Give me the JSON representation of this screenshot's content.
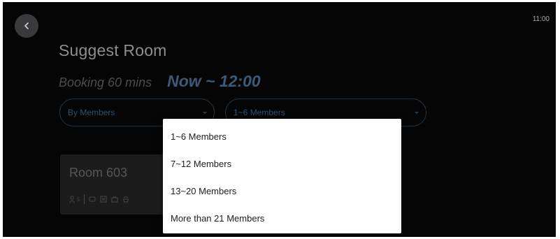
{
  "status_bar": {
    "time": "11:00"
  },
  "header": {
    "back_icon": "chevron-left-icon",
    "title": "Suggest Room"
  },
  "booking": {
    "duration_label": "Booking 60 mins",
    "time_range": "Now ~ 12:00"
  },
  "filters": {
    "sort": {
      "selected": "By Members"
    },
    "capacity": {
      "selected": "1~6 Members",
      "options": [
        "1~6 Members",
        "7~12 Members",
        "13~20 Members",
        "More than 21 Members"
      ],
      "expanded": true
    }
  },
  "rooms": [
    {
      "name": "Room 603",
      "capacity": "5",
      "amenity_icons": [
        "person-icon",
        "screen-icon",
        "whiteboard-icon",
        "tv-icon",
        "phone-icon"
      ]
    }
  ],
  "colors": {
    "background": "#050505",
    "accent": "#3e5978",
    "menu_background": "#ffffff"
  }
}
